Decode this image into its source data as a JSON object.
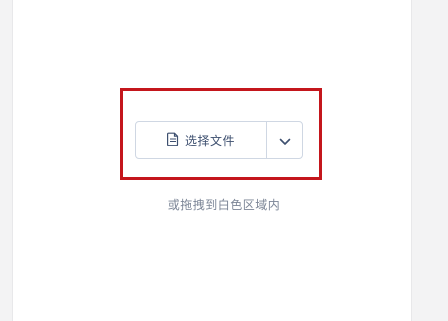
{
  "upload": {
    "choose_file_label": "选择文件",
    "drag_hint": "或拖拽到白色区域内"
  },
  "icons": {
    "file": "file-icon",
    "dropdown": "chevron-down-icon"
  },
  "colors": {
    "highlight_border": "#c4161c",
    "button_border": "#cfd7e3",
    "button_text": "#3d4f6f",
    "hint_text": "#7b8596",
    "page_background": "#f3f3f4",
    "panel_background": "#ffffff"
  }
}
